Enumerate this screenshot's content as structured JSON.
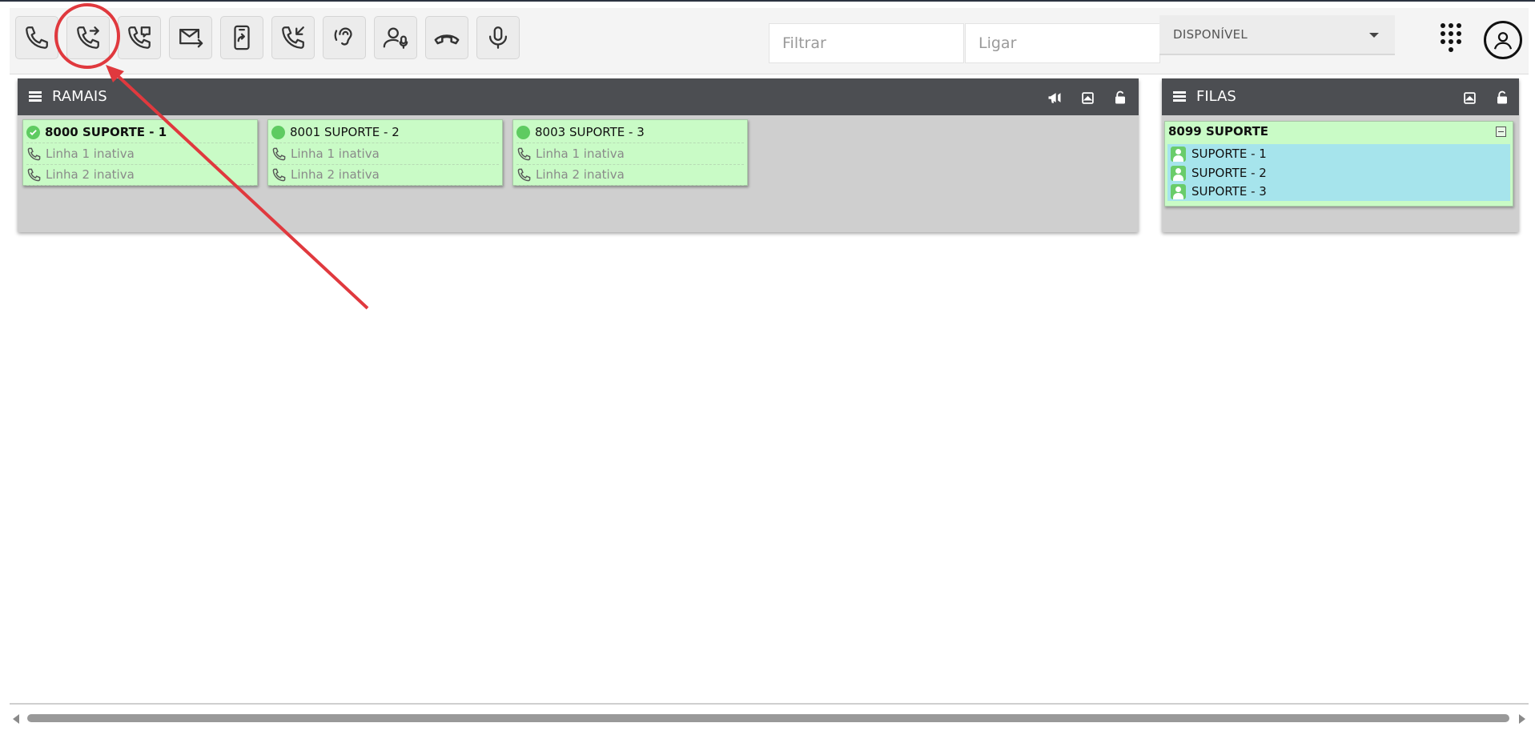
{
  "toolbar": {
    "buttons": [
      {
        "name": "phone-icon"
      },
      {
        "name": "call-transfer-icon"
      },
      {
        "name": "call-consult-icon"
      },
      {
        "name": "mail-forward-icon"
      },
      {
        "name": "mobile-forward-icon"
      },
      {
        "name": "incoming-call-icon"
      },
      {
        "name": "listen-icon"
      },
      {
        "name": "agent-whisper-icon"
      },
      {
        "name": "hangup-icon"
      },
      {
        "name": "microphone-icon"
      }
    ],
    "filter_placeholder": "Filtrar",
    "dial_placeholder": "Ligar",
    "status_value": "DISPONÍVEL"
  },
  "ramais": {
    "title": "RAMAIS",
    "cards": [
      {
        "title": "8000 SUPORTE - 1",
        "status": "ok",
        "line1": "Linha 1 inativa",
        "line2": "Linha 2 inativa"
      },
      {
        "title": "8001 SUPORTE - 2",
        "status": "online",
        "line1": "Linha 1 inativa",
        "line2": "Linha 2 inativa"
      },
      {
        "title": "8003 SUPORTE - 3",
        "status": "online",
        "line1": "Linha 1 inativa",
        "line2": "Linha 2 inativa"
      }
    ]
  },
  "filas": {
    "title": "FILAS",
    "queue": {
      "title": "8099 SUPORTE",
      "members": [
        "SUPORTE - 1",
        "SUPORTE - 2",
        "SUPORTE - 3"
      ]
    }
  },
  "colors": {
    "panel_header": "#4c4e52",
    "card_bg": "#c9fbc6",
    "queue_list_bg": "#a6e4ec",
    "status_green": "#5ecb61",
    "annotation_red": "#e0393e"
  }
}
